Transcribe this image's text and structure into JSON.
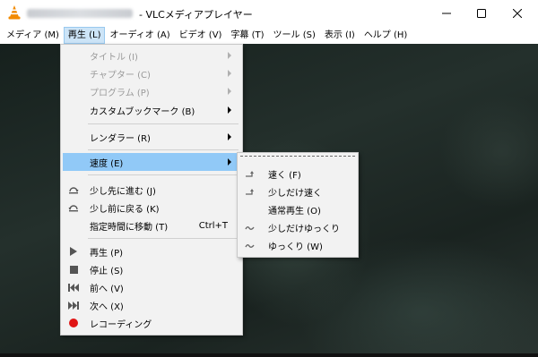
{
  "window": {
    "title": "- VLCメディアプレイヤー"
  },
  "menubar": {
    "items": [
      {
        "label": "メディア (M)"
      },
      {
        "label": "再生 (L)",
        "active": true
      },
      {
        "label": "オーディオ (A)"
      },
      {
        "label": "ビデオ (V)"
      },
      {
        "label": "字幕 (T)"
      },
      {
        "label": "ツール (S)"
      },
      {
        "label": "表示 (I)"
      },
      {
        "label": "ヘルプ (H)"
      }
    ]
  },
  "playback_menu": {
    "title": {
      "label": "タイトル (I)",
      "enabled": false,
      "submenu": true
    },
    "chapter": {
      "label": "チャプター (C)",
      "enabled": false,
      "submenu": true
    },
    "program": {
      "label": "プログラム (P)",
      "enabled": false,
      "submenu": true
    },
    "bookmarks": {
      "label": "カスタムブックマーク (B)",
      "enabled": true,
      "submenu": true
    },
    "renderer": {
      "label": "レンダラー (R)",
      "enabled": true,
      "submenu": true
    },
    "speed": {
      "label": "速度 (E)",
      "enabled": true,
      "submenu": true,
      "highlighted": true
    },
    "jump_forward": {
      "label": "少し先に進む (J)",
      "icon": "jump-forward-icon"
    },
    "jump_backward": {
      "label": "少し前に戻る (K)",
      "icon": "jump-backward-icon"
    },
    "goto_time": {
      "label": "指定時間に移動 (T)",
      "shortcut": "Ctrl+T"
    },
    "play": {
      "label": "再生 (P)",
      "icon": "play-icon"
    },
    "stop": {
      "label": "停止 (S)",
      "icon": "stop-icon"
    },
    "previous": {
      "label": "前へ (V)",
      "icon": "previous-icon"
    },
    "next": {
      "label": "次へ (X)",
      "icon": "next-icon"
    },
    "record": {
      "label": "レコーディング",
      "icon": "record-icon",
      "color": "#e01515"
    }
  },
  "speed_submenu": {
    "faster": {
      "label": "速く (F)",
      "icon": "faster-icon"
    },
    "faster_fine": {
      "label": "少しだけ速く",
      "icon": "faster-fine-icon"
    },
    "normal": {
      "label": "通常再生 (O)"
    },
    "slower_fine": {
      "label": "少しだけゆっくり",
      "icon": "slower-fine-icon"
    },
    "slower": {
      "label": "ゆっくり (W)",
      "icon": "slower-icon"
    }
  },
  "colors": {
    "menu_background": "#f2f2f2",
    "highlight": "#91c9f7",
    "menubar_active": "#cce4f7",
    "vlc_orange": "#f28a00",
    "record_red": "#e01515"
  }
}
